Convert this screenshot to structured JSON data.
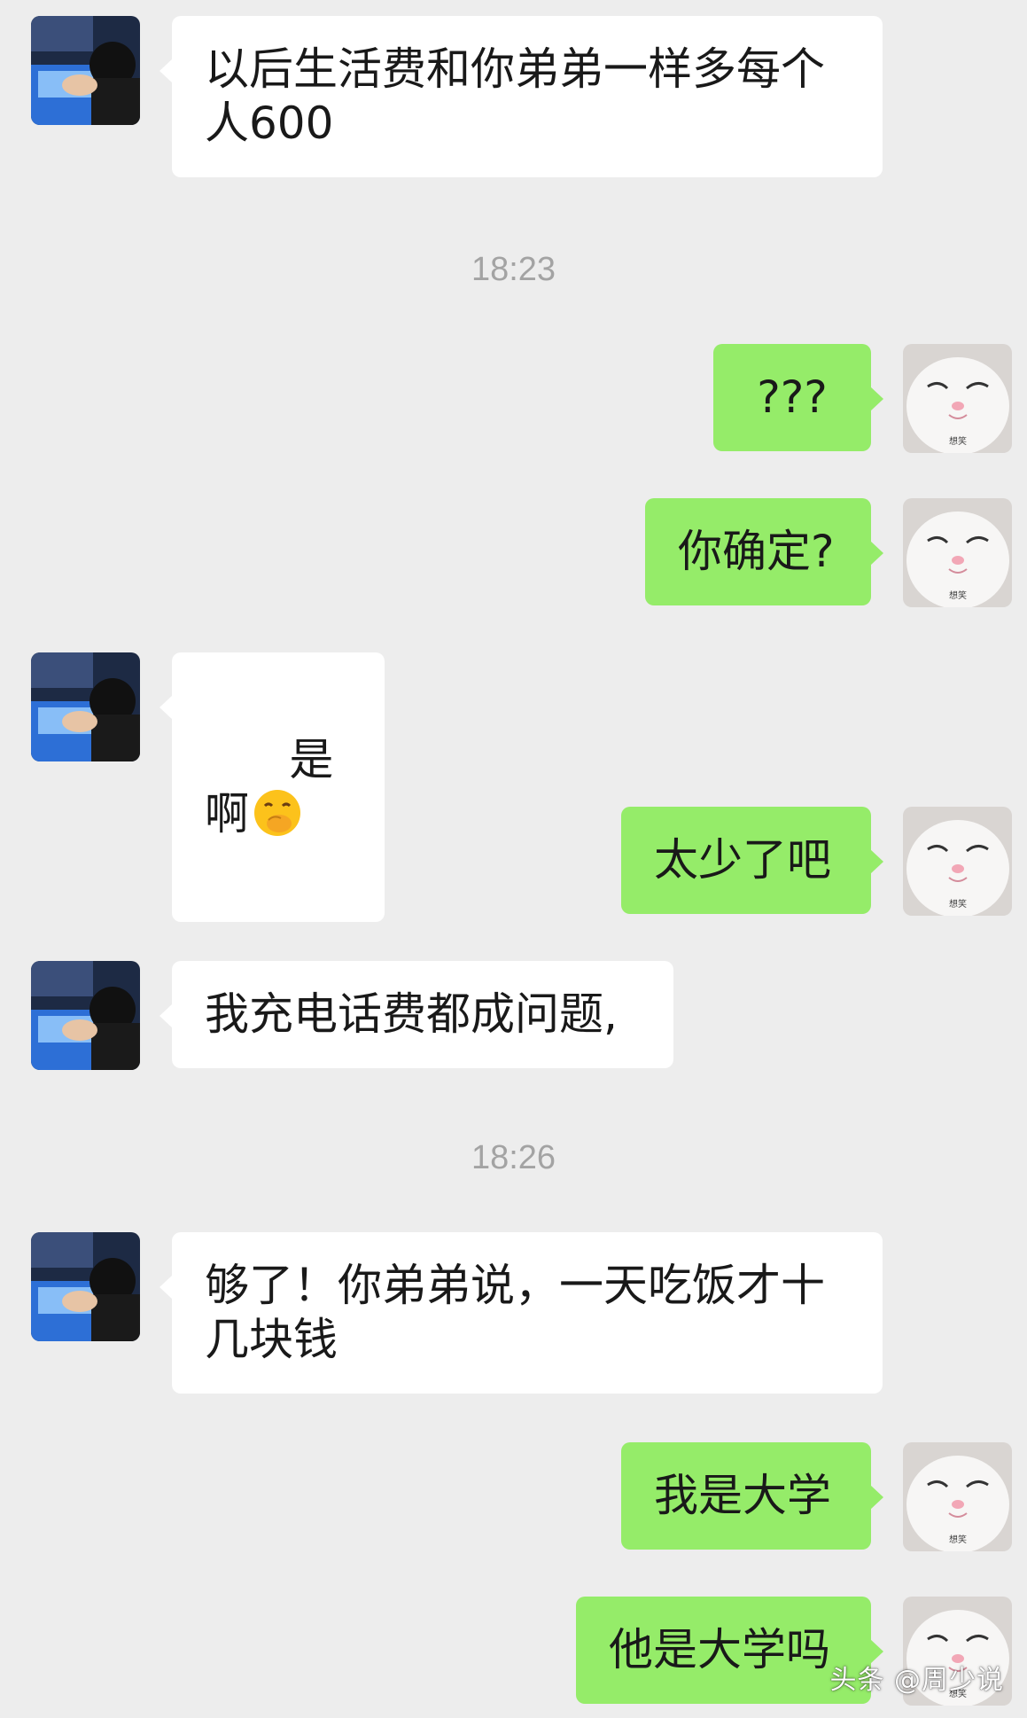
{
  "messages": [
    {
      "side": "left",
      "text": "以后生活费和你弟弟一样多每个人600"
    },
    {
      "timestamp": "18:23"
    },
    {
      "side": "right",
      "text": "???"
    },
    {
      "side": "right",
      "text": "你确定?"
    },
    {
      "side": "left",
      "text": "是啊",
      "emoji": "face-with-hand-over-mouth-emoji"
    },
    {
      "side": "right",
      "text": "太少了吧"
    },
    {
      "side": "left",
      "text": "我充电话费都成问题,"
    },
    {
      "timestamp": "18:26"
    },
    {
      "side": "left",
      "text": "够了！你弟弟说，一天吃饭才十几块钱"
    },
    {
      "side": "right",
      "text": "我是大学"
    },
    {
      "side": "right",
      "text": "他是大学吗"
    }
  ],
  "avatars": {
    "left_icon": "gaming-person-avatar",
    "right_icon": "white-cat-avatar",
    "right_avatar_caption": "想笑"
  },
  "watermark": "头条 @周少说",
  "colors": {
    "background": "#ededed",
    "incoming_bubble": "#ffffff",
    "outgoing_bubble": "#95ec69",
    "timestamp_text": "#a3a3a3"
  }
}
